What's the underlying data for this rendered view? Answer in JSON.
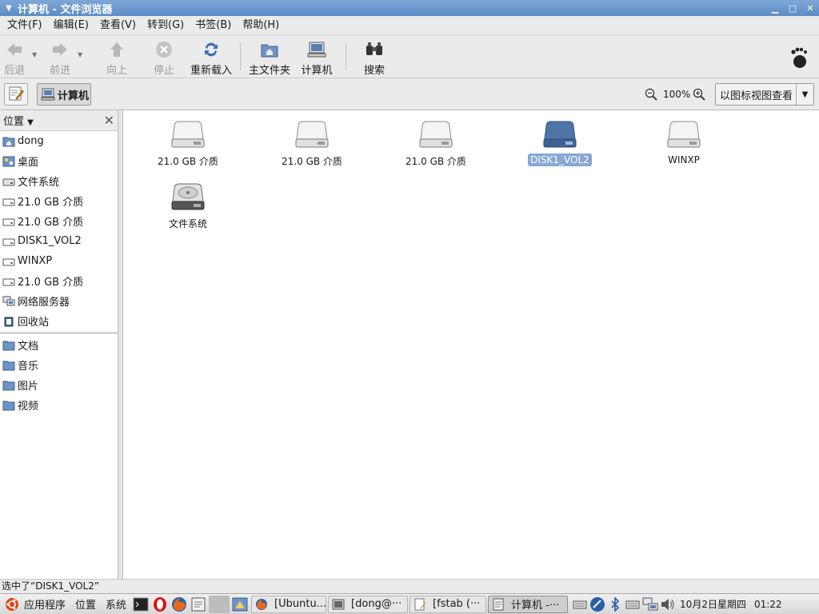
{
  "window": {
    "title": "计算机 - 文件浏览器",
    "buttons": {
      "minimize": "▁",
      "maximize": "□",
      "close": "✕"
    }
  },
  "menubar": [
    {
      "label": "文件(F)"
    },
    {
      "label": "编辑(E)"
    },
    {
      "label": "查看(V)"
    },
    {
      "label": "转到(G)"
    },
    {
      "label": "书签(B)"
    },
    {
      "label": "帮助(H)"
    }
  ],
  "toolbar": {
    "back": "后退",
    "forward": "前进",
    "up": "向上",
    "stop": "停止",
    "reload": "重新载入",
    "home": "主文件夹",
    "computer": "计算机",
    "search": "搜索"
  },
  "location": {
    "path_button": "计算机",
    "zoom_level": "100%",
    "view_mode": "以图标视图查看"
  },
  "sidebar": {
    "header": "位置",
    "places": [
      {
        "label": "dong",
        "icon": "home-folder-icon"
      },
      {
        "label": "桌面",
        "icon": "desktop-icon"
      },
      {
        "label": "文件系统",
        "icon": "filesystem-icon"
      },
      {
        "label": "21.0 GB 介质",
        "icon": "drive-icon"
      },
      {
        "label": "21.0 GB 介质",
        "icon": "drive-icon"
      },
      {
        "label": "DISK1_VOL2",
        "icon": "drive-icon"
      },
      {
        "label": "WINXP",
        "icon": "drive-icon"
      },
      {
        "label": "21.0 GB 介质",
        "icon": "drive-icon"
      },
      {
        "label": "网络服务器",
        "icon": "network-icon"
      },
      {
        "label": "回收站",
        "icon": "trash-icon"
      }
    ],
    "bookmarks": [
      {
        "label": "文档",
        "icon": "folder-icon"
      },
      {
        "label": "音乐",
        "icon": "folder-icon"
      },
      {
        "label": "图片",
        "icon": "folder-icon"
      },
      {
        "label": "视频",
        "icon": "folder-icon"
      }
    ]
  },
  "files": [
    {
      "label": "21.0 GB 介质",
      "kind": "drive",
      "selected": false
    },
    {
      "label": "21.0 GB 介质",
      "kind": "drive",
      "selected": false
    },
    {
      "label": "21.0 GB 介质",
      "kind": "drive",
      "selected": false
    },
    {
      "label": "DISK1_VOL2",
      "kind": "drive",
      "selected": true
    },
    {
      "label": "WINXP",
      "kind": "drive",
      "selected": false
    },
    {
      "label": "文件系统",
      "kind": "filesystem",
      "selected": false
    }
  ],
  "status": {
    "text": "选中了“DISK1_VOL2”"
  },
  "panel": {
    "apps_menu": "应用程序",
    "places_menu": "位置",
    "system_menu": "系统",
    "tasks": [
      {
        "label": "[Ubuntu...",
        "icon": "firefox-icon"
      },
      {
        "label": "[dong@···",
        "icon": "terminal-icon"
      },
      {
        "label": "[fstab (···",
        "icon": "text-editor-icon"
      },
      {
        "label": "计算机 -···",
        "icon": "file-browser-icon"
      }
    ],
    "clock_date": "10月2日星期四",
    "clock_time": "01:22"
  }
}
